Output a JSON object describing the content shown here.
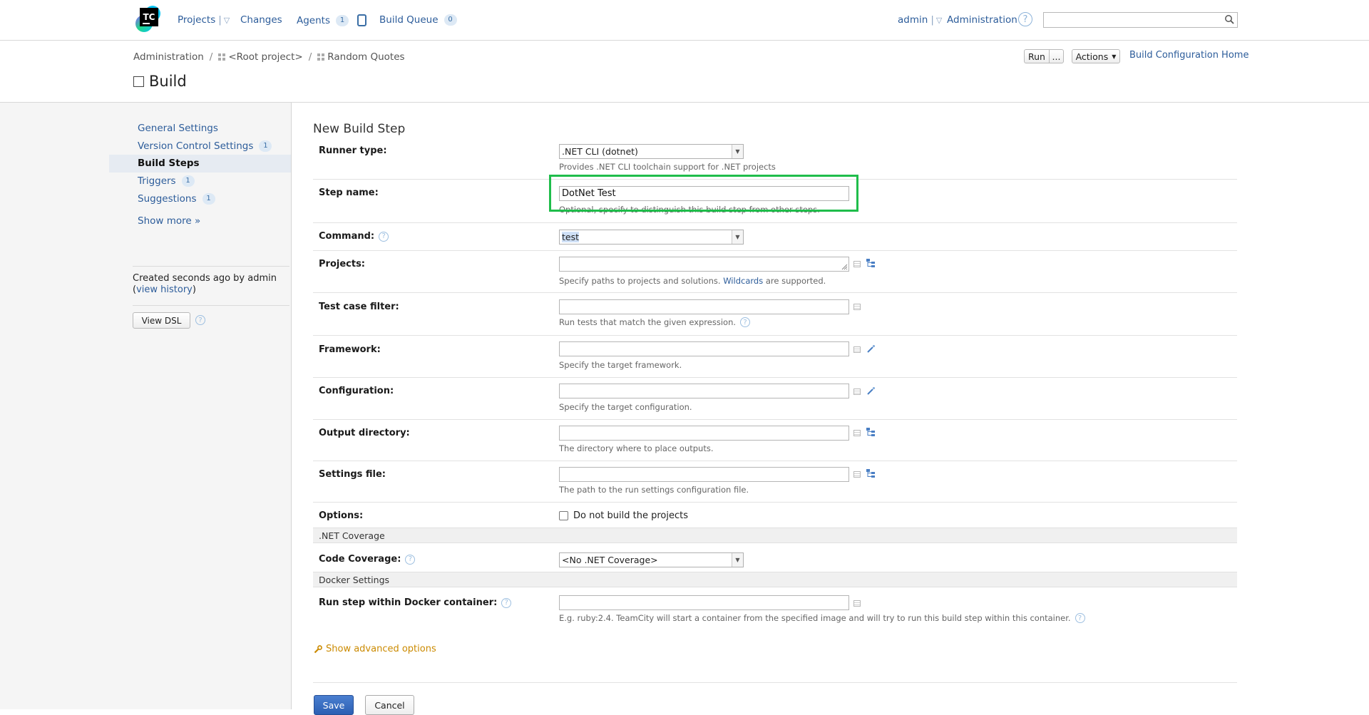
{
  "header": {
    "logo_text": "TC",
    "nav": {
      "projects": "Projects",
      "changes": "Changes",
      "agents": "Agents",
      "agents_count": "1",
      "build_queue": "Build Queue",
      "build_queue_count": "0"
    },
    "user": "admin",
    "administration": "Administration",
    "search_value": ""
  },
  "breadcrumb": {
    "items": [
      "Administration",
      "<Root project>",
      "Random Quotes"
    ]
  },
  "page_title": "Build",
  "actions": {
    "run": "Run",
    "run_more": "...",
    "actions": "Actions",
    "home": "Build Configuration Home"
  },
  "sidebar": {
    "items": [
      {
        "label": "General Settings",
        "count": ""
      },
      {
        "label": "Version Control Settings",
        "count": "1"
      },
      {
        "label": "Build Steps",
        "count": ""
      },
      {
        "label": "Triggers",
        "count": "1"
      },
      {
        "label": "Suggestions",
        "count": "1"
      }
    ],
    "show_more": "Show more »",
    "created_text": "Created seconds ago by admin",
    "view_history_prefix": "(",
    "view_history": "view history",
    "view_history_suffix": ")",
    "view_dsl": "View DSL"
  },
  "form": {
    "heading": "New Build Step",
    "runner_type": {
      "label": "Runner type:",
      "value": ".NET CLI (dotnet)",
      "hint": "Provides .NET CLI toolchain support for .NET projects"
    },
    "step_name": {
      "label": "Step name:",
      "value": "DotNet Test",
      "hint": "Optional, specify to distinguish this build step from other steps."
    },
    "command": {
      "label": "Command:",
      "value": "test"
    },
    "projects": {
      "label": "Projects:",
      "value": "",
      "hint_prefix": "Specify paths to projects and solutions. ",
      "hint_link": "Wildcards",
      "hint_suffix": " are supported."
    },
    "test_case_filter": {
      "label": "Test case filter:",
      "value": "",
      "hint": "Run tests that match the given expression."
    },
    "framework": {
      "label": "Framework:",
      "value": "",
      "hint": "Specify the target framework."
    },
    "configuration": {
      "label": "Configuration:",
      "value": "",
      "hint": "Specify the target configuration."
    },
    "output_directory": {
      "label": "Output directory:",
      "value": "",
      "hint": "The directory where to place outputs."
    },
    "settings_file": {
      "label": "Settings file:",
      "value": "",
      "hint": "The path to the run settings configuration file."
    },
    "options": {
      "label": "Options:",
      "checkbox_label": "Do not build the projects",
      "checked": false
    },
    "net_coverage_section": ".NET Coverage",
    "code_coverage": {
      "label": "Code Coverage:",
      "value": "<No .NET Coverage>"
    },
    "docker_section": "Docker Settings",
    "docker": {
      "label": "Run step within Docker container:",
      "value": "",
      "hint": "E.g. ruby:2.4. TeamCity will start a container from the specified image and will try to run this build step within this container."
    },
    "show_advanced": "Show advanced options",
    "save": "Save",
    "cancel": "Cancel"
  },
  "colors": {
    "link": "#2c5c9a",
    "highlight": "#1fbd4b",
    "save_button": "#2c5fb3",
    "advanced_link": "#cb8a00"
  }
}
